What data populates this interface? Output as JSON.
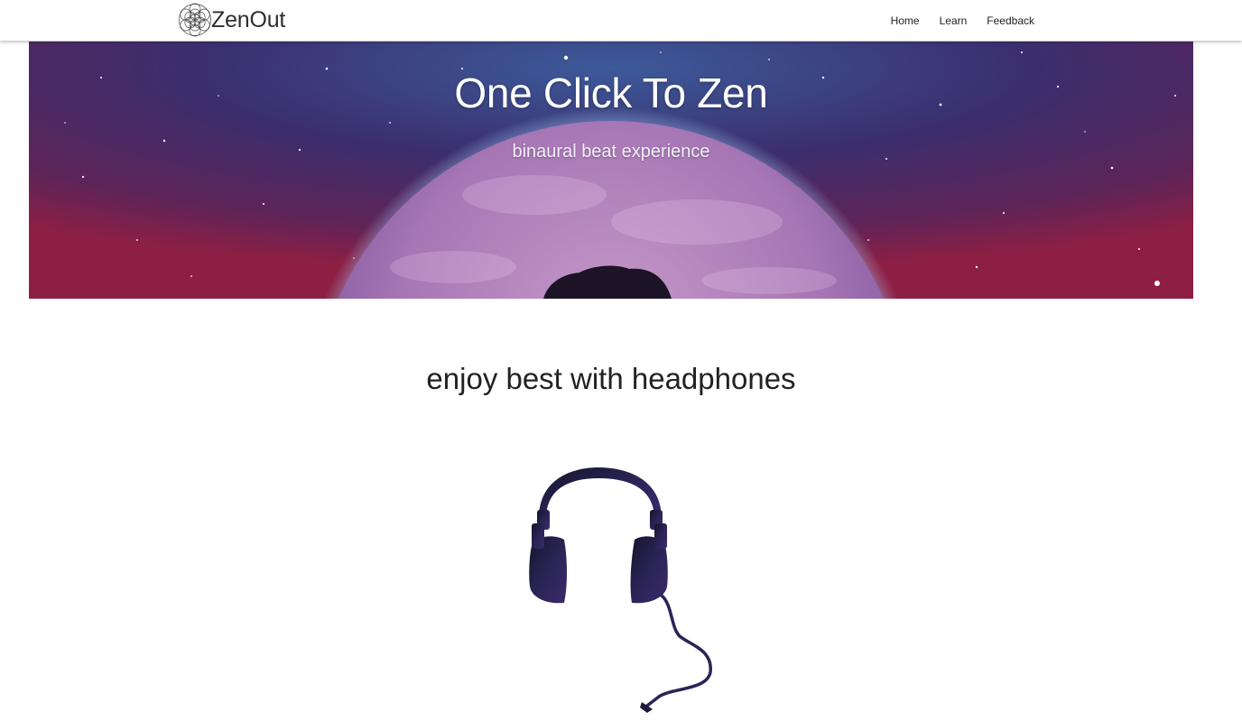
{
  "nav": {
    "brand": "ZenOut",
    "links": [
      "Home",
      "Learn",
      "Feedback"
    ]
  },
  "hero": {
    "title": "One Click To Zen",
    "subtitle": "binaural beat experience"
  },
  "main": {
    "heading": "enjoy best with headphones"
  },
  "icons": {
    "logo": "flower-of-life-icon",
    "headphones": "headphones-icon"
  },
  "colors": {
    "text": "#212121",
    "hero_top": "#1a2550",
    "hero_bottom": "#8a2048",
    "planet": "#b98bc2"
  }
}
